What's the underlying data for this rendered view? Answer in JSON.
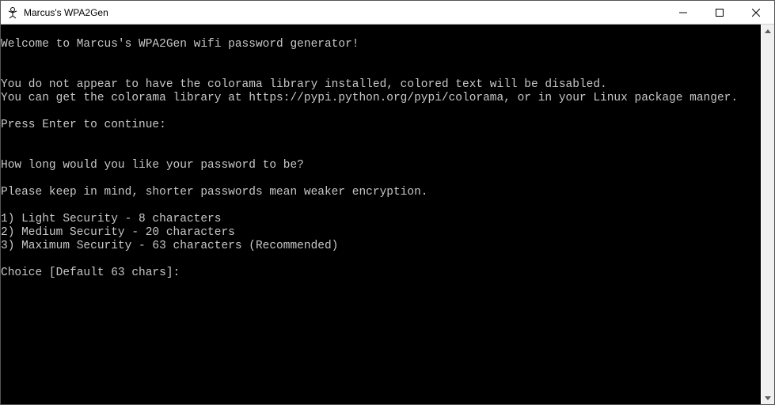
{
  "window": {
    "title": "Marcus's WPA2Gen"
  },
  "console": {
    "lines": [
      "",
      "Welcome to Marcus's WPA2Gen wifi password generator!",
      "",
      "",
      "You do not appear to have the colorama library installed, colored text will be disabled.",
      "You can get the colorama library at https://pypi.python.org/pypi/colorama, or in your Linux package manger.",
      "",
      "Press Enter to continue:",
      "",
      "",
      "How long would you like your password to be?",
      "",
      "Please keep in mind, shorter passwords mean weaker encryption.",
      "",
      "1) Light Security - 8 characters",
      "2) Medium Security - 20 characters",
      "3) Maximum Security - 63 characters (Recommended)",
      "",
      "Choice [Default 63 chars]:"
    ]
  }
}
